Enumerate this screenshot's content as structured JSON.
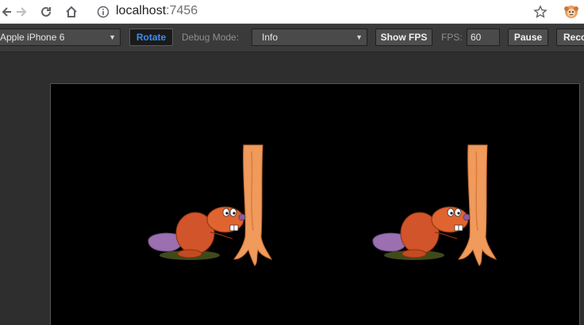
{
  "browser": {
    "url_host": "localhost",
    "url_port": ":7456"
  },
  "toolbar": {
    "device_select": "Apple iPhone 6",
    "rotate_label": "Rotate",
    "debug_mode_label": "Debug Mode:",
    "debug_mode_value": "Info",
    "show_fps_label": "Show FPS",
    "fps_label": "FPS:",
    "fps_value": "60",
    "pause_label": "Pause",
    "record_label": "Reco"
  },
  "colors": {
    "rotate_accent": "#3e8df0",
    "tree": "#f0a060",
    "beaver_body": "#d2542a",
    "beaver_tail": "#9b6fb0"
  },
  "scene": {
    "sprites": [
      "beaver-with-tree",
      "beaver-with-tree"
    ]
  }
}
